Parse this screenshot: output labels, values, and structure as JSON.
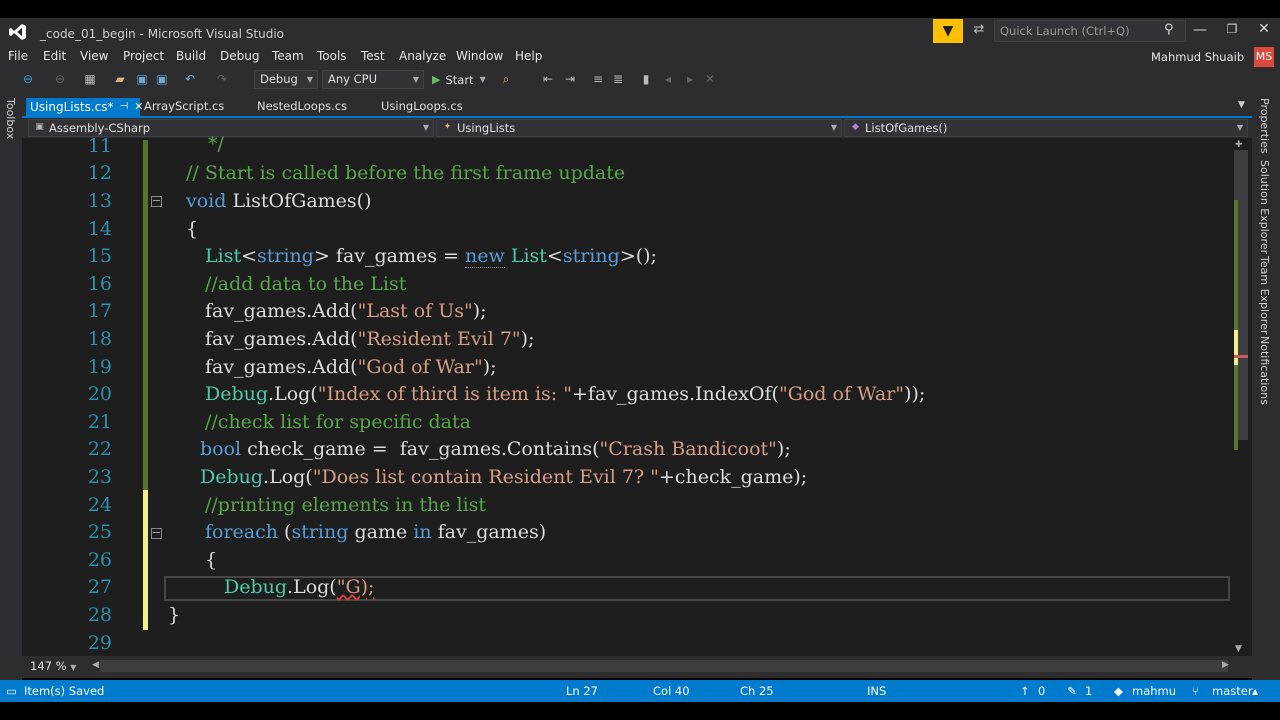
{
  "window": {
    "title": "_code_01_begin - Microsoft Visual Studio",
    "quick_launch_placeholder": "Quick Launch (Ctrl+Q)",
    "user_name": "Mahmud Shuaib",
    "user_initials": "MS"
  },
  "menu": [
    "File",
    "Edit",
    "View",
    "Project",
    "Build",
    "Debug",
    "Team",
    "Tools",
    "Test",
    "Analyze",
    "Window",
    "Help"
  ],
  "toolbar": {
    "configuration": "Debug",
    "platform": "Any CPU",
    "start_label": "Start"
  },
  "side_panels": {
    "left": "Toolbox",
    "right": [
      "Properties",
      "Solution Explorer",
      "Team Explorer",
      "Notifications"
    ]
  },
  "tabs": [
    {
      "label": "UsingLists.cs*",
      "active": true
    },
    {
      "label": "ArrayScript.cs",
      "active": false
    },
    {
      "label": "NestedLoops.cs",
      "active": false
    },
    {
      "label": "UsingLoops.cs",
      "active": false
    }
  ],
  "nav": {
    "project": "Assembly-CSharp",
    "class": "UsingLists",
    "member": "ListOfGames()"
  },
  "code": {
    "line_numbers": [
      "11",
      "12",
      "13",
      "14",
      "15",
      "16",
      "17",
      "18",
      "19",
      "20",
      "21",
      "22",
      "23",
      "24",
      "25",
      "26",
      "27",
      "28",
      "29"
    ],
    "l11": "*/",
    "l12": "// Start is called before the first frame update",
    "l13_kw": "void",
    "l13_rest": " ListOfGames()",
    "l14": "{",
    "l15_ty1": "List",
    "l15_a": "<",
    "l15_kw1": "string",
    "l15_b": "> fav_games = ",
    "l15_kw2": "new",
    "l15_c": " ",
    "l15_ty2": "List",
    "l15_d": "<",
    "l15_kw3": "string",
    "l15_e": ">();",
    "l16": "//add data to the List",
    "l17_a": "fav_games.Add(",
    "l17_str": "\"Last of Us\"",
    "l17_b": ");",
    "l18_a": "fav_games.Add(",
    "l18_str": "\"Resident Evil 7\"",
    "l18_b": ");",
    "l19_a": "fav_games.Add(",
    "l19_str": "\"God of War\"",
    "l19_b": ");",
    "l20_ty": "Debug",
    "l20_a": ".Log(",
    "l20_str1": "\"Index of third is item is: \"",
    "l20_b": "+fav_games.IndexOf(",
    "l20_str2": "\"God of War\"",
    "l20_c": "));",
    "l21": "//check list for specific data",
    "l22_kw": "bool",
    "l22_a": " check_game =  fav_games.Contains(",
    "l22_str": "\"Crash Bandicoot\"",
    "l22_b": ");",
    "l23_ty": "Debug",
    "l23_a": ".Log(",
    "l23_str": "\"Does list contain Resident Evil 7? \"",
    "l23_b": "+check_game);",
    "l24": "//printing elements in the list",
    "l25_kw1": "foreach",
    "l25_a": " (",
    "l25_kw2": "string",
    "l25_b": " game ",
    "l25_kw3": "in",
    "l25_c": " fav_games)",
    "l26": "{",
    "l27_ty": "Debug",
    "l27_a": ".Log(",
    "l27_str": "\"G);",
    "l28": "}"
  },
  "editor": {
    "zoom": "147 %"
  },
  "status": {
    "message": "Item(s) Saved",
    "ln": "Ln 27",
    "col": "Col 40",
    "ch": "Ch 25",
    "mode": "INS",
    "up_count": "0",
    "edit_count": "1",
    "repo": "mahmu",
    "branch": "master"
  }
}
